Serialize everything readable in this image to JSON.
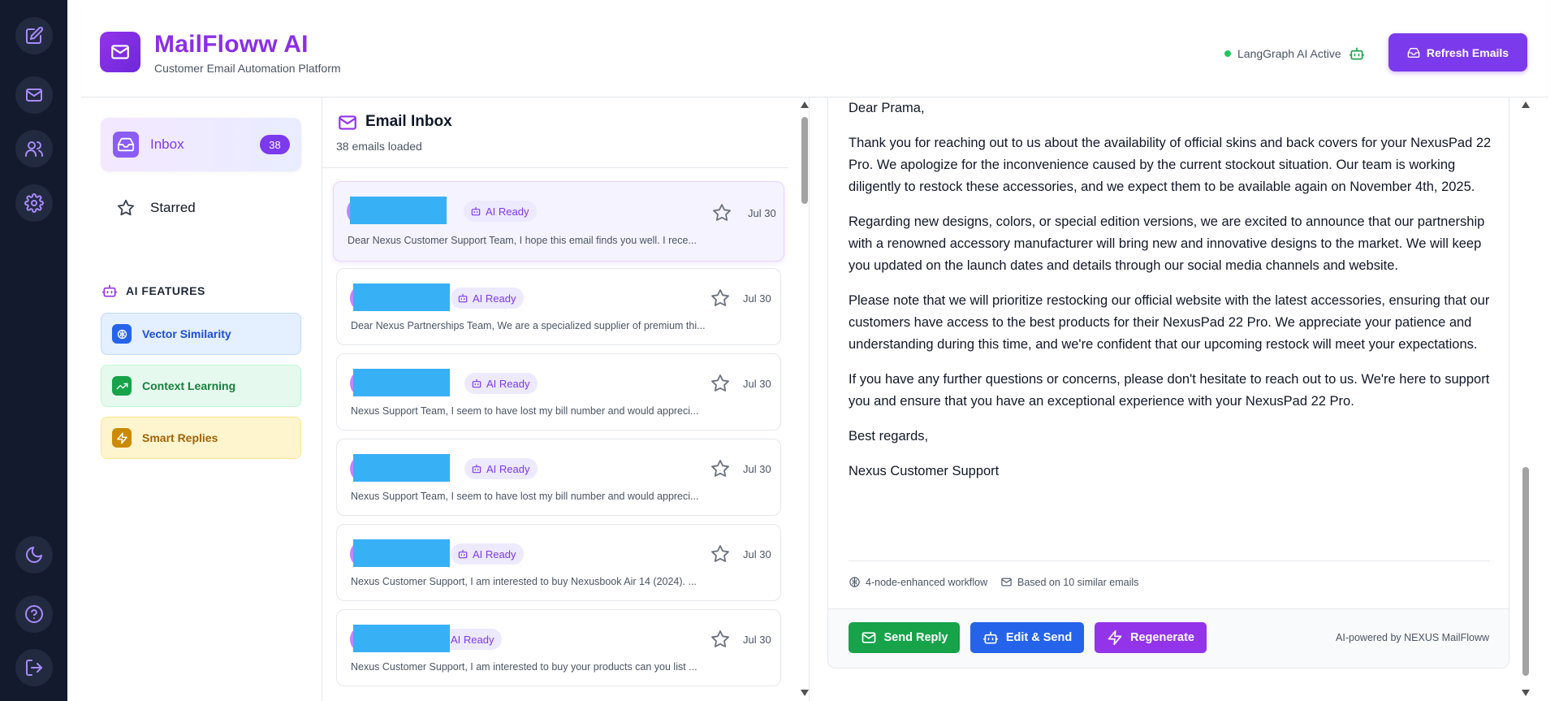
{
  "app": {
    "title": "MailFloww AI",
    "subtitle": "Customer Email Automation Platform",
    "status_text": "LangGraph AI Active",
    "refresh_label": "Refresh Emails"
  },
  "rail": {
    "icons": [
      "compose-icon",
      "mail-icon",
      "users-icon",
      "settings-icon",
      "moon-icon",
      "help-icon",
      "logout-icon"
    ]
  },
  "nav": {
    "inbox_label": "Inbox",
    "inbox_count": "38",
    "starred_label": "Starred",
    "features_heading": "AI FEATURES",
    "features": [
      {
        "label": "Vector Similarity",
        "color": "#2563eb"
      },
      {
        "label": "Context Learning",
        "color": "#16a34a"
      },
      {
        "label": "Smart Replies",
        "color": "#ca8a04"
      }
    ]
  },
  "inbox": {
    "title": "Email Inbox",
    "count_text": "38 emails loaded",
    "emails": [
      {
        "tag": "AI Ready",
        "date": "Jul 30",
        "preview": "Dear Nexus Customer Support Team, I hope this email finds you well. I rece...",
        "active": true
      },
      {
        "tag": "AI Ready",
        "date": "Jul 30",
        "preview": "Dear Nexus Partnerships Team, We are a specialized supplier of premium thi..."
      },
      {
        "tag": "AI Ready",
        "date": "Jul 30",
        "preview": "Nexus Support Team, I seem to have lost my bill number and would appreci..."
      },
      {
        "tag": "AI Ready",
        "date": "Jul 30",
        "preview": "Nexus Support Team, I seem to have lost my bill number and would appreci..."
      },
      {
        "tag": "AI Ready",
        "date": "Jul 30",
        "preview": "Nexus Customer Support, I am interested to buy Nexusbook Air 14 (2024). ..."
      },
      {
        "tag": "AI Ready",
        "date": "Jul 30",
        "preview": "Nexus Customer Support, I am interested to buy your products can you list ..."
      }
    ]
  },
  "reply": {
    "paragraphs": [
      "Dear Prama,",
      "Thank you for reaching out to us about the availability of official skins and back covers for your NexusPad 22 Pro. We apologize for the inconvenience caused by the current stockout situation. Our team is working diligently to restock these accessories, and we expect them to be available again on November 4th, 2025.",
      "Regarding new designs, colors, or special edition versions, we are excited to announce that our partnership with a renowned accessory manufacturer will bring new and innovative designs to the market. We will keep you updated on the launch dates and details through our social media channels and website.",
      "Please note that we will prioritize restocking our official website with the latest accessories, ensuring that our customers have access to the best products for their NexusPad 22 Pro. We appreciate your patience and understanding during this time, and we're confident that our upcoming restock will meet your expectations.",
      "If you have any further questions or concerns, please don't hesitate to reach out to us. We're here to support you and ensure that you have an exceptional experience with your NexusPad 22 Pro.",
      "Best regards,",
      "Nexus Customer Support"
    ],
    "meta_workflow": "4-node-enhanced workflow",
    "meta_similar": "Based on 10 similar emails",
    "send_label": "Send Reply",
    "edit_label": "Edit & Send",
    "regen_label": "Regenerate",
    "powered_by": "AI-powered by NEXUS MailFloww"
  },
  "colors": {
    "accent": "#7c3aed",
    "brand": "#8b2fe4",
    "send": "#16a34a",
    "edit": "#2563eb",
    "regen": "#9333ea",
    "rail": "#141a2e",
    "redaction": "#38b0f5"
  }
}
